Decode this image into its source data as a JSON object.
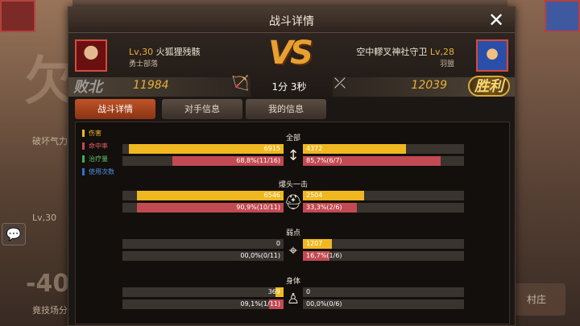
{
  "background": {
    "big_text": "欠",
    "side_text_1": "破坏气力",
    "side_text_2": "Lv,30",
    "side_text_3": "竟技场分",
    "minus_text": "-40",
    "village_button": "村庄"
  },
  "window": {
    "title": "战斗详情",
    "close_label": "✕"
  },
  "left_player": {
    "level_prefix": "Lv,30",
    "name": "火狐狸残骸",
    "guild": "勇士部落",
    "result": "败北",
    "score": "11984"
  },
  "right_player": {
    "level_suffix": "Lv,28",
    "name": "空中轇叉神社守卫",
    "guild": "羽盟",
    "result": "胜利",
    "score": "12039"
  },
  "vs_label": "VS",
  "duration": "1分 3秒",
  "tabs": [
    {
      "label": "战斗详情",
      "active": true
    },
    {
      "label": "对手信息",
      "active": false
    },
    {
      "label": "我的信息",
      "active": false
    }
  ],
  "legend": [
    {
      "label": "伤害",
      "color": "#f0b820",
      "text_color": "#f0b820"
    },
    {
      "label": "命中率",
      "color": "#c24a52",
      "text_color": "#e06060"
    },
    {
      "label": "治疗量",
      "color": "#40b050",
      "text_color": "#60c060"
    },
    {
      "label": "使用次数",
      "color": "#3070d0",
      "text_color": "#5090e0"
    }
  ],
  "sections": [
    {
      "label": "全部",
      "icon": "arrow-updown-icon",
      "left_damage": "6915",
      "left_damage_frac": 0.96,
      "left_hit": "68,8%(11/16)",
      "left_hit_frac": 0.688,
      "right_damage": "4372",
      "right_damage_frac": 0.64,
      "right_hit": "85,7%(6/7)",
      "right_hit_frac": 0.857
    },
    {
      "label": "爆头一击",
      "icon": "helmet-icon",
      "left_damage": "6546",
      "left_damage_frac": 0.91,
      "left_hit": "90,9%(10/11)",
      "left_hit_frac": 0.909,
      "right_damage": "2504",
      "right_damage_frac": 0.38,
      "right_hit": "33,3%(2/6)",
      "right_hit_frac": 0.333
    },
    {
      "label": "弱点",
      "icon": "target-icon",
      "left_damage": "0",
      "left_damage_frac": 0.0,
      "left_hit": "00,0%(0/11)",
      "left_hit_frac": 0.0,
      "right_damage": "1207",
      "right_damage_frac": 0.18,
      "right_hit": "16,7%(1/6)",
      "right_hit_frac": 0.167
    },
    {
      "label": "身体",
      "icon": "body-icon",
      "left_damage": "369",
      "left_damage_frac": 0.05,
      "left_hit": "09,1%(1/11)",
      "left_hit_frac": 0.091,
      "right_damage": "0",
      "right_damage_frac": 0.0,
      "right_hit": "00,0%(0/6)",
      "right_hit_frac": 0.0
    }
  ],
  "colors": {
    "accent": "#e8b038",
    "damage_bar": "#f0b820",
    "hit_bar": "#c24a52",
    "active_tab": "#c05428"
  }
}
